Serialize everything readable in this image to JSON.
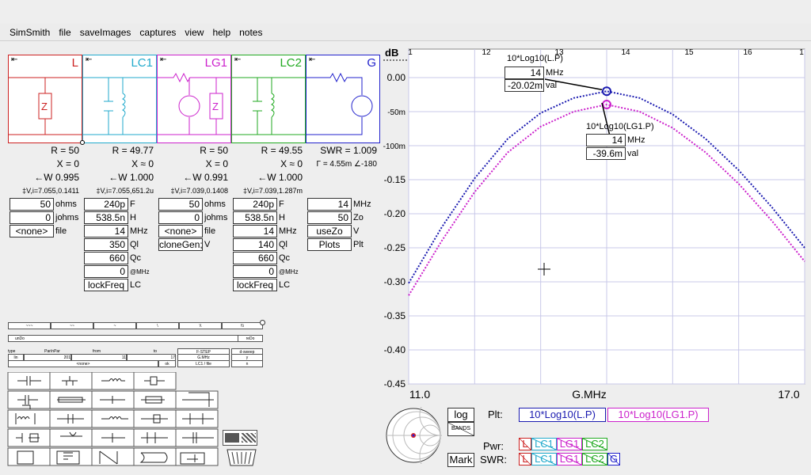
{
  "menu": [
    "SimSmith",
    "file",
    "saveImages",
    "captures",
    "view",
    "help",
    "notes"
  ],
  "blocks": [
    {
      "name": "L",
      "color": "#cc2222",
      "icon": "⇤"
    },
    {
      "name": "LC1",
      "color": "#22aacc",
      "icon": "⇤"
    },
    {
      "name": "LG1",
      "color": "#cc22cc",
      "icon": "⇤"
    },
    {
      "name": "LC2",
      "color": "#22aa22",
      "icon": "⇤"
    },
    {
      "name": "G",
      "color": "#2222cc",
      "icon": "⇤"
    }
  ],
  "params": [
    {
      "r": "R = 50",
      "x": "X = 0",
      "w": "←W 0.995",
      "v": "‡V,i=7.055,0.1411"
    },
    {
      "r": "R = 49.77",
      "x": "X ≈ 0",
      "w": "←W 1.000",
      "v": "‡V,i=7.055,651.2u"
    },
    {
      "r": "R = 50",
      "x": "X = 0",
      "w": "←W 0.991",
      "v": "‡V,i=7.039,0.1408"
    },
    {
      "r": "R = 49.55",
      "x": "X ≈ 0",
      "w": "←W 1.000",
      "v": "‡V,i=7.039,1.287m"
    },
    {
      "r": "SWR = 1.009",
      "x": "Γ = 4.55m ∠-180",
      "w": "",
      "v": ""
    }
  ],
  "fields": {
    "L": [
      {
        "v": "50",
        "u": "ohms"
      },
      {
        "v": "0",
        "u": "johms"
      },
      {
        "v": "<none>",
        "u": "file"
      }
    ],
    "LC1": [
      {
        "v": "240p",
        "u": "F"
      },
      {
        "v": "538.5n",
        "u": "H"
      },
      {
        "v": "14",
        "u": "MHz"
      },
      {
        "v": "350",
        "u": "Ql"
      },
      {
        "v": "660",
        "u": "Qc"
      },
      {
        "v": "0",
        "u": "@MHz"
      },
      {
        "v": "lockFreq",
        "u": "LC"
      }
    ],
    "LG1": [
      {
        "v": "50",
        "u": "ohms"
      },
      {
        "v": "0",
        "u": "johms"
      },
      {
        "v": "<none>",
        "u": "file"
      },
      {
        "v": "cloneGen;",
        "u": "V"
      }
    ],
    "LC2": [
      {
        "v": "240p",
        "u": "F"
      },
      {
        "v": "538.5n",
        "u": "H"
      },
      {
        "v": "14",
        "u": "MHz"
      },
      {
        "v": "140",
        "u": "Ql"
      },
      {
        "v": "660",
        "u": "Qc"
      },
      {
        "v": "0",
        "u": "@MHz"
      },
      {
        "v": "lockFreq",
        "u": "LC"
      }
    ],
    "G": [
      {
        "v": "14",
        "u": "MHz"
      },
      {
        "v": "50",
        "u": "Zo"
      },
      {
        "v": "useZo",
        "u": "V"
      },
      {
        "v": "Plots",
        "u": "Plt"
      }
    ]
  },
  "tool_strip": [
    "~~~",
    "~~",
    "~",
    "\\",
    "\\\\",
    "\\\\\\"
  ],
  "undo": {
    "undo": "unDo",
    "redo": "reDo"
  },
  "small_row": {
    "labels": [
      "type",
      "Par/nPar",
      "from",
      "to"
    ],
    "values": [
      "lin",
      "201",
      "11",
      "17"
    ],
    "file": "<none>",
    "ok": "ok",
    "fstep_label": "F-STEP",
    "fstep_unit": "G.MHz",
    "fstep_note": "LC1 / file",
    "dsweep_label": "d-sweep",
    "dsweep_v1": "y",
    "dsweep_v2": "n"
  },
  "chart_data": {
    "type": "line",
    "ylabel": "dB",
    "xlabel": "G.MHz",
    "xlim": [
      11.0,
      17.0
    ],
    "ylim": [
      -0.45,
      0.0
    ],
    "x_ticks_top": [
      "1",
      "12",
      "13",
      "14",
      "15",
      "16",
      "1"
    ],
    "x_ticks_bottom": [
      "11.0",
      "G.MHz",
      "17.0"
    ],
    "y_ticks": [
      "0.00",
      "-50m",
      "-100m",
      "-0.15",
      "-0.20",
      "-0.25",
      "-0.30",
      "-0.35",
      "-0.40",
      "-0.45"
    ],
    "series": [
      {
        "name": "10*Log10(L.P)",
        "color": "#1a1ab0",
        "x": [
          11.0,
          11.5,
          12.0,
          12.5,
          13.0,
          13.5,
          14.0,
          14.5,
          15.0,
          15.5,
          16.0,
          16.5,
          17.0
        ],
        "y": [
          -0.302,
          -0.22,
          -0.148,
          -0.09,
          -0.052,
          -0.03,
          -0.02,
          -0.03,
          -0.054,
          -0.09,
          -0.136,
          -0.19,
          -0.25
        ]
      },
      {
        "name": "10*Log10(LG1.P)",
        "color": "#cc22cc",
        "x": [
          11.0,
          11.5,
          12.0,
          12.5,
          13.0,
          13.5,
          14.0,
          14.5,
          15.0,
          15.5,
          16.0,
          16.5,
          17.0
        ],
        "y": [
          -0.32,
          -0.24,
          -0.168,
          -0.11,
          -0.072,
          -0.05,
          -0.0396,
          -0.05,
          -0.074,
          -0.11,
          -0.156,
          -0.21,
          -0.27
        ]
      }
    ],
    "markers": [
      {
        "title": "10*Log10(L.P)",
        "mhz": "14",
        "mhz_unit": "MHz",
        "val": "-20.02m",
        "val_unit": "val",
        "x": 14,
        "y": -0.02
      },
      {
        "title": "10*Log10(LG1.P)",
        "mhz": "14",
        "mhz_unit": "MHz",
        "val": "-39.6m",
        "val_unit": "val",
        "x": 14,
        "y": -0.0396
      }
    ]
  },
  "bottom": {
    "log": "log",
    "bands": "BANDS",
    "mark": "Mark",
    "plt_label": "Plt:",
    "pwr_label": "Pwr:",
    "swr_label": "SWR:",
    "plot_boxes": [
      "10*Log10(L.P)",
      "10*Log10(LG1.P)"
    ],
    "pwr_items": [
      "L",
      "LC1",
      "LG1",
      "LC2"
    ],
    "swr_items": [
      "L",
      "LC1",
      "LG1",
      "LC2",
      "G"
    ]
  }
}
